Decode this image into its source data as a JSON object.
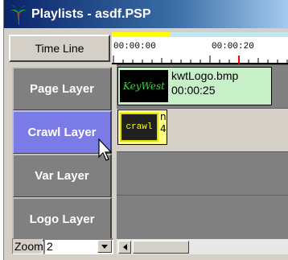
{
  "window": {
    "title": "Playlists - asdf.PSP"
  },
  "timeline": {
    "button_label": "Time Line",
    "ticks": [
      "00:00:00",
      "00:00:20"
    ]
  },
  "layers": [
    {
      "label": "Page Layer"
    },
    {
      "label": "Crawl Layer"
    },
    {
      "label": "Var Layer"
    },
    {
      "label": "Logo Layer"
    }
  ],
  "clips": {
    "page": {
      "thumb_text": "KeyWest",
      "name": "kwtLogo.bmp",
      "duration": "00:00:25"
    },
    "crawl": {
      "thumb_text": "crawl",
      "name": "n",
      "duration": "4"
    }
  },
  "zoom": {
    "label": "Zoom",
    "value": "2"
  },
  "colors": {
    "title_bar": "#0a246a",
    "layer_button": "#808080",
    "active_layer": "#7b7be8",
    "page_clip": "#c8f0c8",
    "crawl_clip": "#ffff80",
    "ruler_played": "#ffff00",
    "ruler_remaining": "#c0e8f0"
  }
}
